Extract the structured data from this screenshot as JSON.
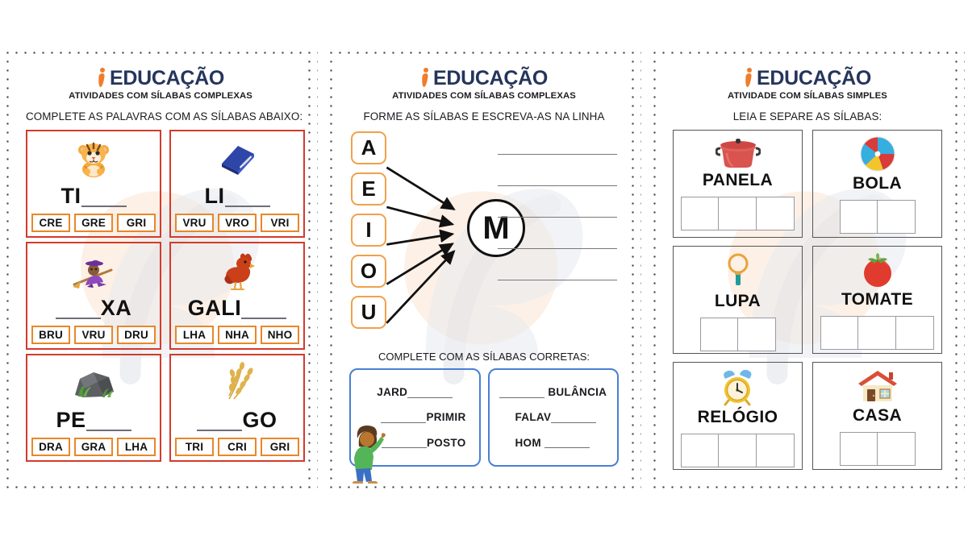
{
  "brand": {
    "name": "EDUCAÇÃO",
    "mark": "i-logo-mark"
  },
  "pages": [
    {
      "id": "page-1",
      "subtitle": "ATIVIDADES COM SÍLABAS COMPLEXAS",
      "instruction": "COMPLETE AS PALAVRAS COM AS SÍLABAS ABAIXO:",
      "cards": [
        {
          "icon": "tiger-icon",
          "prefix": "TI",
          "suffix": "",
          "blank": "after",
          "options": [
            "CRE",
            "GRE",
            "GRI"
          ]
        },
        {
          "icon": "book-icon",
          "prefix": "LI",
          "suffix": "",
          "blank": "after",
          "options": [
            "VRU",
            "VRO",
            "VRI"
          ]
        },
        {
          "icon": "witch-icon",
          "prefix": "",
          "suffix": "XA",
          "blank": "before",
          "options": [
            "BRU",
            "VRU",
            "DRU"
          ]
        },
        {
          "icon": "hen-icon",
          "prefix": "GALI",
          "suffix": "",
          "blank": "after",
          "options": [
            "LHA",
            "NHA",
            "NHO"
          ]
        },
        {
          "icon": "rock-icon",
          "prefix": "PE",
          "suffix": "",
          "blank": "after",
          "options": [
            "DRA",
            "GRA",
            "LHA"
          ]
        },
        {
          "icon": "wheat-icon",
          "prefix": "",
          "suffix": "GO",
          "blank": "before",
          "options": [
            "TRI",
            "CRI",
            "GRI"
          ]
        }
      ]
    },
    {
      "id": "page-2",
      "subtitle": "ATIVIDADES COM SÍLABAS COMPLEXAS",
      "instruction": "FORME AS SÍLABAS E ESCREVA-AS NA LINHA",
      "vowels": [
        "A",
        "E",
        "I",
        "O",
        "U"
      ],
      "consonant": "M",
      "answer_lines": 5,
      "sub_instruction": "COMPLETE COM AS SÍLABAS CORRETAS:",
      "blue_cards": [
        {
          "items": [
            {
              "text": "JARD",
              "blank": "after",
              "align": "c"
            },
            {
              "text": "PRIMIR",
              "blank": "before",
              "align": "r"
            },
            {
              "text": "POSTO",
              "blank": "before",
              "align": "r"
            }
          ]
        },
        {
          "items": [
            {
              "text": "BULÂNCIA",
              "blank": "before",
              "align": "c"
            },
            {
              "text": "FALAV",
              "blank": "after",
              "align": "l"
            },
            {
              "text": "HOM",
              "blank": "after",
              "align": "l"
            }
          ]
        }
      ],
      "illustration": "boy-writing-icon"
    },
    {
      "id": "page-3",
      "subtitle": "ATIVIDADE COM SÍLABAS SIMPLES",
      "instruction": "LEIA E SEPARE AS SÍLABAS:",
      "cards": [
        {
          "icon": "pot-icon",
          "word": "PANELA",
          "boxes": 3
        },
        {
          "icon": "ball-icon",
          "word": "BOLA",
          "boxes": 2
        },
        {
          "icon": "magnifier-icon",
          "word": "LUPA",
          "boxes": 2
        },
        {
          "icon": "tomato-icon",
          "word": "TOMATE",
          "boxes": 3
        },
        {
          "icon": "clock-icon",
          "word": "RELÓGIO",
          "boxes": 3
        },
        {
          "icon": "house-icon",
          "word": "CASA",
          "boxes": 2
        }
      ]
    }
  ],
  "colors": {
    "brand_navy": "#25355c",
    "brand_orange": "#f07d2b",
    "card_red": "#d23b2b",
    "syllable_orange": "#e8872a",
    "blue_card": "#4a7fd4",
    "vowel_orange": "#f0a14a",
    "watermark_peach": "#fdf0e6",
    "watermark_grey": "#e7e9ee"
  }
}
